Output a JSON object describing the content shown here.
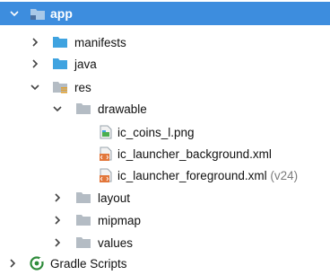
{
  "tree": {
    "root": {
      "label": "app"
    },
    "manifests": {
      "label": "manifests"
    },
    "java": {
      "label": "java"
    },
    "res": {
      "label": "res"
    },
    "drawable": {
      "label": "drawable"
    },
    "files": [
      {
        "label": "ic_coins_l.png",
        "hint": ""
      },
      {
        "label": "ic_launcher_background.xml",
        "hint": ""
      },
      {
        "label": "ic_launcher_foreground.xml",
        "hint": "(v24)"
      }
    ],
    "layout": {
      "label": "layout"
    },
    "mipmap": {
      "label": "mipmap"
    },
    "values": {
      "label": "values"
    },
    "gradle": {
      "label": "Gradle Scripts"
    }
  },
  "colors": {
    "selection": "#3d8dde",
    "folder_blue": "#3fa3e0",
    "folder_gray": "#b4bcc4",
    "gradle_green": "#2e8b3a",
    "xml_orange": "#e2763a"
  }
}
